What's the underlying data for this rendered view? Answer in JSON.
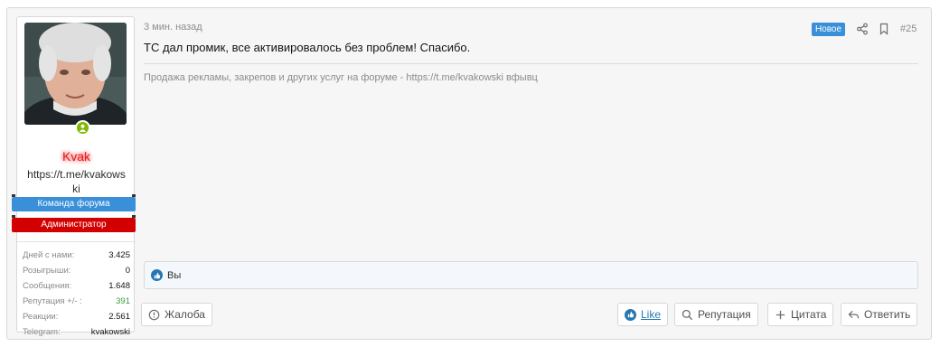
{
  "user": {
    "name": "Kvak",
    "title": "https://t.me/kvakowski",
    "banners": [
      "Команда форума",
      "Администратор"
    ],
    "stats": [
      {
        "label": "Дней с нами:",
        "value": "3.425"
      },
      {
        "label": "Розыгрыши:",
        "value": "0"
      },
      {
        "label": "Сообщения:",
        "value": "1.648"
      },
      {
        "label": "Репутация +/- :",
        "value": "391"
      },
      {
        "label": "Реакции:",
        "value": "2.561"
      },
      {
        "label": "Telegram:",
        "value": "kvakowski"
      }
    ]
  },
  "post": {
    "time": "3 мин. назад",
    "badge": "Новое",
    "number": "#25",
    "message": "ТС дал промик, все активировалось без проблем! Спасибо.",
    "signature": "Продажа рекламы, закрепов и других услуг на форуме - https://t.me/kvakowski вфывц",
    "reactions_text": "Вы"
  },
  "actions": {
    "report": "Жалоба",
    "like": "Like",
    "reputation": "Репутация",
    "quote": "Цитата",
    "reply": "Ответить"
  },
  "colors": {
    "accent": "#3a8fd9",
    "admin": "#d20000",
    "name": "#e21e1e",
    "online": "#7fb900"
  }
}
